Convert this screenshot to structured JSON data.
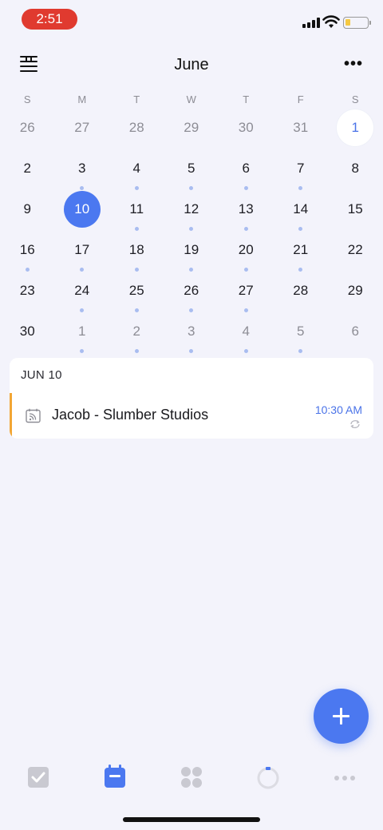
{
  "status_bar": {
    "time": "2:51"
  },
  "header": {
    "title": "June",
    "more_label": "•••"
  },
  "weekdays": [
    "S",
    "M",
    "T",
    "W",
    "T",
    "F",
    "S"
  ],
  "calendar": {
    "weeks": [
      [
        {
          "n": "26",
          "muted": true,
          "dot": false
        },
        {
          "n": "27",
          "muted": true,
          "dot": false
        },
        {
          "n": "28",
          "muted": true,
          "dot": false
        },
        {
          "n": "29",
          "muted": true,
          "dot": false
        },
        {
          "n": "30",
          "muted": true,
          "dot": false
        },
        {
          "n": "31",
          "muted": true,
          "dot": false
        },
        {
          "n": "1",
          "today": true,
          "dot": false
        }
      ],
      [
        {
          "n": "2",
          "dot": false
        },
        {
          "n": "3",
          "dot": true
        },
        {
          "n": "4",
          "dot": true
        },
        {
          "n": "5",
          "dot": true
        },
        {
          "n": "6",
          "dot": true
        },
        {
          "n": "7",
          "dot": true
        },
        {
          "n": "8",
          "dot": false
        }
      ],
      [
        {
          "n": "9",
          "dot": false
        },
        {
          "n": "10",
          "selected": true,
          "dot": false
        },
        {
          "n": "11",
          "dot": true
        },
        {
          "n": "12",
          "dot": true
        },
        {
          "n": "13",
          "dot": true
        },
        {
          "n": "14",
          "dot": true
        },
        {
          "n": "15",
          "dot": false
        }
      ],
      [
        {
          "n": "16",
          "dot": true
        },
        {
          "n": "17",
          "dot": true
        },
        {
          "n": "18",
          "dot": true
        },
        {
          "n": "19",
          "dot": true
        },
        {
          "n": "20",
          "dot": true
        },
        {
          "n": "21",
          "dot": true
        },
        {
          "n": "22",
          "dot": false
        }
      ],
      [
        {
          "n": "23",
          "dot": false
        },
        {
          "n": "24",
          "dot": true
        },
        {
          "n": "25",
          "dot": true
        },
        {
          "n": "26",
          "dot": true
        },
        {
          "n": "27",
          "dot": true
        },
        {
          "n": "28",
          "dot": false
        },
        {
          "n": "29",
          "dot": false
        }
      ],
      [
        {
          "n": "30",
          "dot": false
        },
        {
          "n": "1",
          "muted": true,
          "dot": true
        },
        {
          "n": "2",
          "muted": true,
          "dot": true
        },
        {
          "n": "3",
          "muted": true,
          "dot": true
        },
        {
          "n": "4",
          "muted": true,
          "dot": true
        },
        {
          "n": "5",
          "muted": true,
          "dot": true
        },
        {
          "n": "6",
          "muted": true,
          "dot": false
        }
      ]
    ]
  },
  "agenda": {
    "date_label": "JUN 10",
    "events": [
      {
        "title": "Jacob - Slumber Studios",
        "time": "10:30 AM",
        "repeat": true
      }
    ]
  },
  "colors": {
    "accent": "#4b78f0",
    "event_bar": "#f2a634",
    "background": "#f3f3fb",
    "dot": "#a9bdf0"
  },
  "tabbar": {
    "items": [
      {
        "icon": "checkbox-icon",
        "active": false
      },
      {
        "icon": "calendar-icon",
        "active": true
      },
      {
        "icon": "grid-icon",
        "active": false
      },
      {
        "icon": "focus-timer-icon",
        "active": false
      },
      {
        "icon": "more-icon",
        "active": false
      }
    ]
  }
}
